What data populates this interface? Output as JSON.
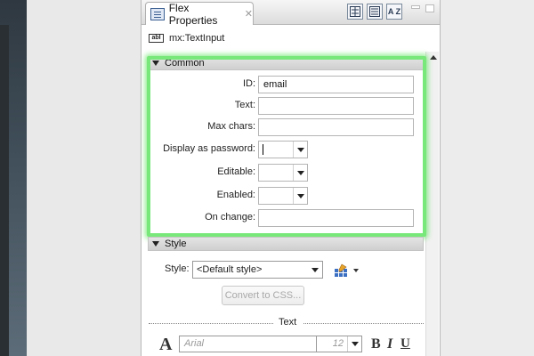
{
  "panel": {
    "tab_label": "Flex Properties",
    "tab_close": "✕",
    "toolbar": {
      "categories_view": "categories-view-icon",
      "list_view": "list-view-icon",
      "sort_alpha": "A Z"
    },
    "component": {
      "icon_text": "abI",
      "name": "mx:TextInput"
    }
  },
  "common": {
    "title": "Common",
    "fields": {
      "id": {
        "label": "ID:",
        "value": "email"
      },
      "text": {
        "label": "Text:",
        "value": ""
      },
      "max_chars": {
        "label": "Max chars:",
        "value": ""
      },
      "display_as_password": {
        "label": "Display as password:",
        "value": ""
      },
      "editable": {
        "label": "Editable:",
        "value": ""
      },
      "enabled": {
        "label": "Enabled:",
        "value": ""
      },
      "on_change": {
        "label": "On change:",
        "value": ""
      }
    }
  },
  "style": {
    "title": "Style",
    "style_label": "Style:",
    "style_value": "<Default style>",
    "convert_button": "Convert to CSS...",
    "text_separator": "Text",
    "font_icon_glyph": "A",
    "font_value": "Arial",
    "size_value": "12",
    "bold": "B",
    "italic": "I",
    "underline": "U"
  },
  "colors": {
    "highlight": "#78e87a",
    "header_bg": "#d8d8d8"
  }
}
